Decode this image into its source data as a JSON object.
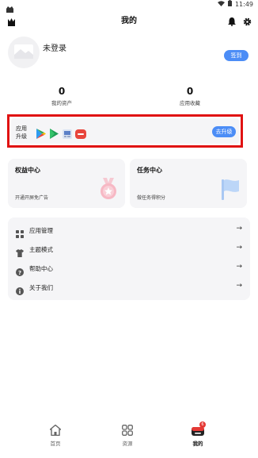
{
  "status_bar": {
    "time": "11:49"
  },
  "header": {
    "title": "我的"
  },
  "profile": {
    "login_text": "未登录",
    "checkin_label": "签到"
  },
  "stats": [
    {
      "value": "0",
      "label": "我的资产"
    },
    {
      "value": "0",
      "label": "应用收藏"
    }
  ],
  "upgrade": {
    "label_line1": "应用",
    "label_line2": "升级",
    "button_label": "去升级"
  },
  "promo": {
    "rights": {
      "title": "权益中心",
      "subtitle": "开通开屏免广告"
    },
    "tasks": {
      "title": "任务中心",
      "subtitle": "做任务得积分"
    }
  },
  "menu": [
    {
      "label": "应用管理",
      "icon": "grid-icon"
    },
    {
      "label": "主题模式",
      "icon": "shirt-icon"
    },
    {
      "label": "帮助中心",
      "icon": "help-icon"
    },
    {
      "label": "关于我们",
      "icon": "info-icon"
    }
  ],
  "bottom_nav": [
    {
      "label": "首页",
      "icon": "home-icon"
    },
    {
      "label": "资源",
      "icon": "resources-icon"
    },
    {
      "label": "我的",
      "icon": "profile-icon",
      "badge": "6"
    }
  ],
  "colors": {
    "accent": "#4c8df6",
    "highlight_border": "#e01212"
  }
}
